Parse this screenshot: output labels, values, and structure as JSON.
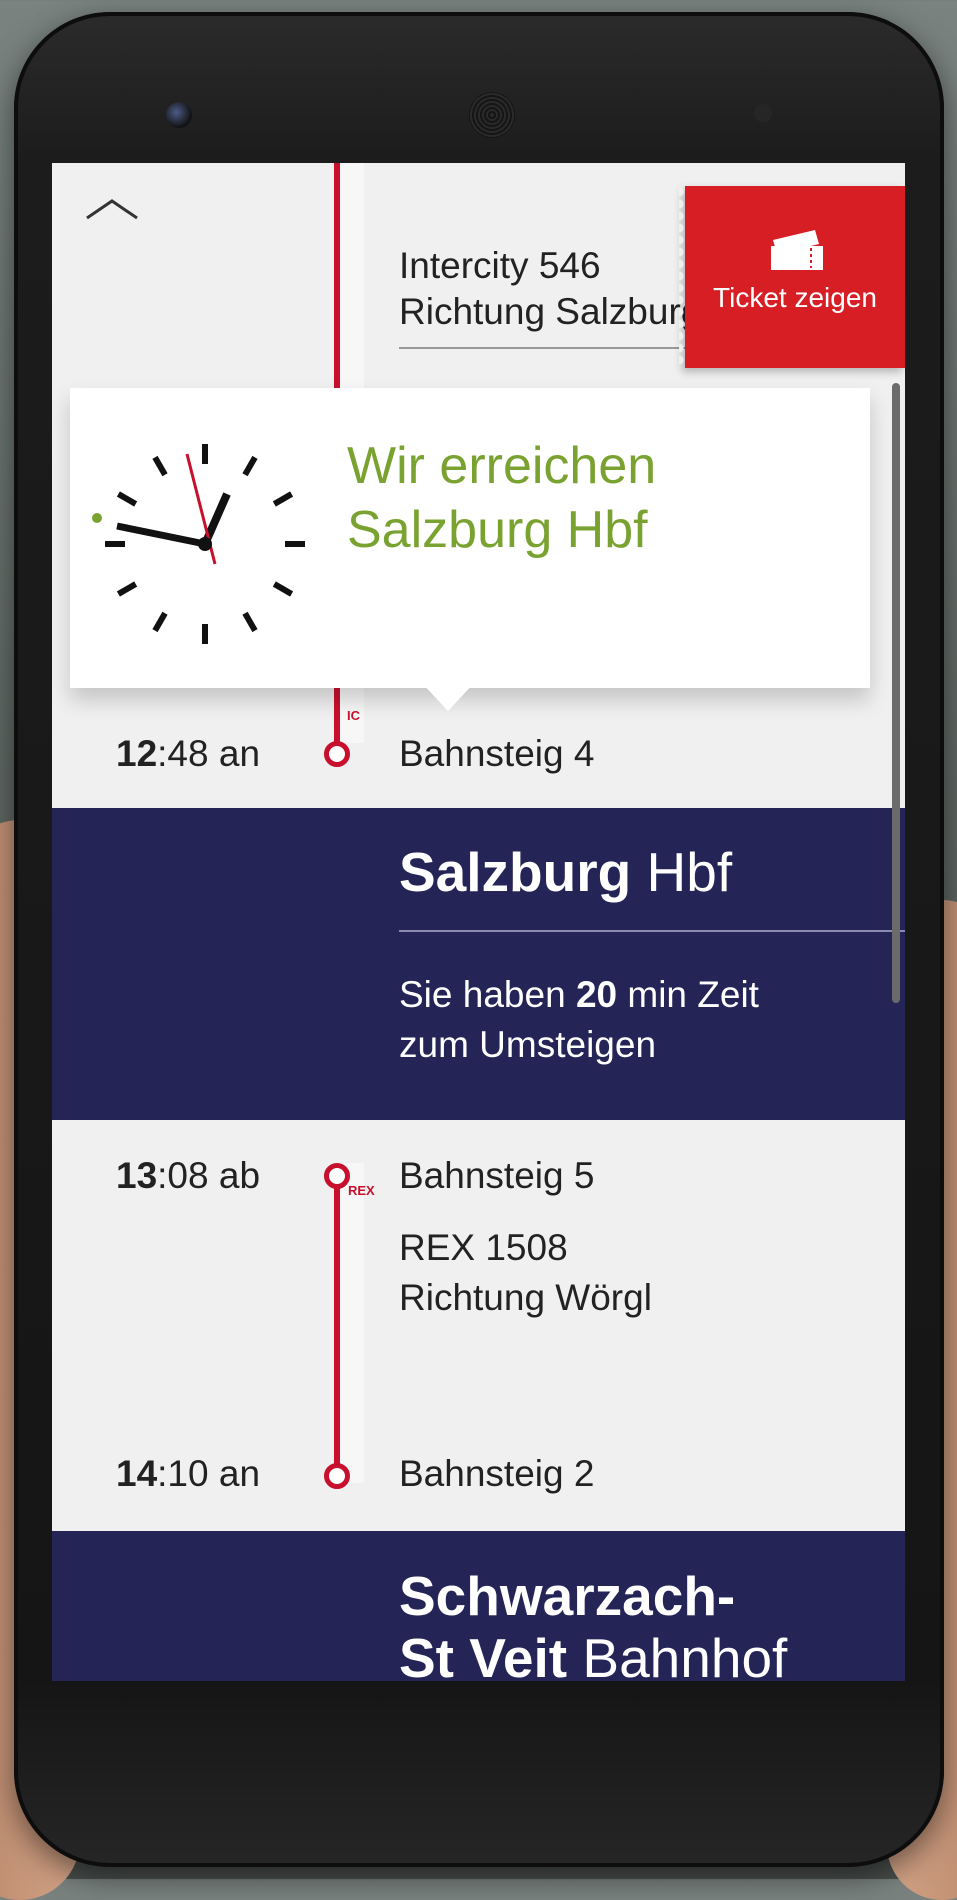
{
  "header": {
    "train_name": "Intercity 546",
    "train_direction": "Richtung Salzburg",
    "ticket_button_label": "Ticket zeigen"
  },
  "popup": {
    "message": "Wir erreichen Salzburg Hbf"
  },
  "first_leg": {
    "train_tag": "IC",
    "arrival_hour": "12",
    "arrival_rest": ":48 an",
    "arrival_platform": "Bahnsteig 4"
  },
  "transfer_station": {
    "name_bold": "Salzburg",
    "name_rest": "Hbf",
    "transfer_prefix": "Sie haben ",
    "transfer_minutes": "20",
    "transfer_suffix": " min Zeit zum Umsteigen"
  },
  "second_leg": {
    "train_tag": "REX",
    "departure_hour": "13",
    "departure_rest": ":08 ab",
    "departure_platform": "Bahnsteig 5",
    "train_name": "REX 1508",
    "train_direction": "Richtung Wörgl",
    "arrival_hour": "14",
    "arrival_rest": ":10 an",
    "arrival_platform": "Bahnsteig 2"
  },
  "final_station": {
    "name_bold_line1": "Schwarzach-",
    "name_bold_line2": "St Veit",
    "name_rest": "Bahnhof"
  },
  "colors": {
    "accent_red": "#d71e24",
    "navy": "#252457",
    "popup_green": "#7aa230"
  },
  "icons": [
    "chevron-up-icon",
    "ticket-icon",
    "clock-icon"
  ]
}
